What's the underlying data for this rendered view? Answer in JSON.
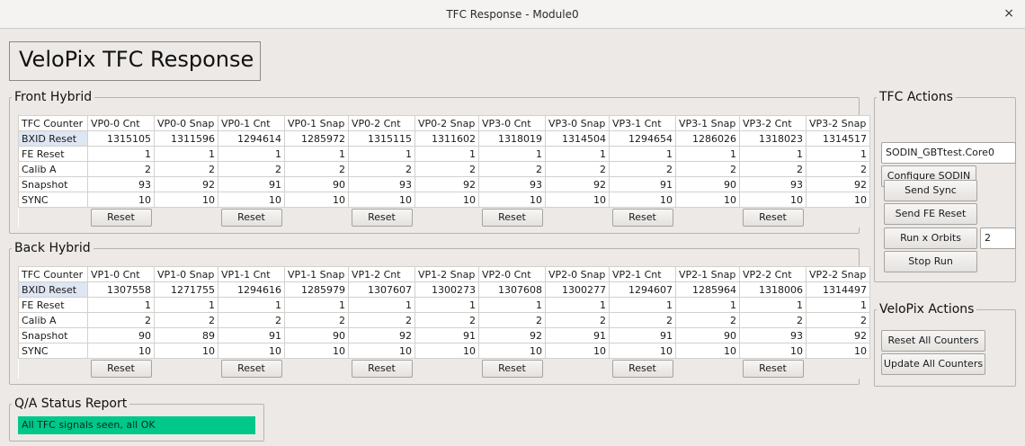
{
  "window": {
    "title": "TFC Response - Module0",
    "close": "×"
  },
  "app_title": "VeloPix TFC Response",
  "front": {
    "legend": "Front Hybrid",
    "header": [
      "TFC Counter",
      "VP0-0 Cnt",
      "VP0-0 Snap",
      "VP0-1 Cnt",
      "VP0-1 Snap",
      "VP0-2 Cnt",
      "VP0-2 Snap",
      "VP3-0 Cnt",
      "VP3-0 Snap",
      "VP3-1 Cnt",
      "VP3-1 Snap",
      "VP3-2 Cnt",
      "VP3-2 Snap"
    ],
    "rows": [
      {
        "label": "BXID Reset",
        "values": [
          "1315105",
          "1311596",
          "1294614",
          "1285972",
          "1315115",
          "1311602",
          "1318019",
          "1314504",
          "1294654",
          "1286026",
          "1318023",
          "1314517"
        ]
      },
      {
        "label": "FE Reset",
        "values": [
          "1",
          "1",
          "1",
          "1",
          "1",
          "1",
          "1",
          "1",
          "1",
          "1",
          "1",
          "1"
        ]
      },
      {
        "label": "Calib A",
        "values": [
          "2",
          "2",
          "2",
          "2",
          "2",
          "2",
          "2",
          "2",
          "2",
          "2",
          "2",
          "2"
        ]
      },
      {
        "label": "Snapshot",
        "values": [
          "93",
          "92",
          "91",
          "90",
          "93",
          "92",
          "93",
          "92",
          "91",
          "90",
          "93",
          "92"
        ]
      },
      {
        "label": "SYNC",
        "values": [
          "10",
          "10",
          "10",
          "10",
          "10",
          "10",
          "10",
          "10",
          "10",
          "10",
          "10",
          "10"
        ]
      }
    ],
    "reset_label": "Reset"
  },
  "back": {
    "legend": "Back Hybrid",
    "header": [
      "TFC Counter",
      "VP1-0 Cnt",
      "VP1-0 Snap",
      "VP1-1 Cnt",
      "VP1-1 Snap",
      "VP1-2 Cnt",
      "VP1-2 Snap",
      "VP2-0 Cnt",
      "VP2-0 Snap",
      "VP2-1 Cnt",
      "VP2-1 Snap",
      "VP2-2 Cnt",
      "VP2-2 Snap"
    ],
    "rows": [
      {
        "label": "BXID Reset",
        "values": [
          "1307558",
          "1271755",
          "1294616",
          "1285979",
          "1307607",
          "1300273",
          "1307608",
          "1300277",
          "1294607",
          "1285964",
          "1318006",
          "1314497"
        ]
      },
      {
        "label": "FE Reset",
        "values": [
          "1",
          "1",
          "1",
          "1",
          "1",
          "1",
          "1",
          "1",
          "1",
          "1",
          "1",
          "1"
        ]
      },
      {
        "label": "Calib A",
        "values": [
          "2",
          "2",
          "2",
          "2",
          "2",
          "2",
          "2",
          "2",
          "2",
          "2",
          "2",
          "2"
        ]
      },
      {
        "label": "Snapshot",
        "values": [
          "90",
          "89",
          "91",
          "90",
          "92",
          "91",
          "92",
          "91",
          "91",
          "90",
          "93",
          "92"
        ]
      },
      {
        "label": "SYNC",
        "values": [
          "10",
          "10",
          "10",
          "10",
          "10",
          "10",
          "10",
          "10",
          "10",
          "10",
          "10",
          "10"
        ]
      }
    ],
    "reset_label": "Reset"
  },
  "qa": {
    "legend": "Q/A Status Report",
    "status_text": "All TFC signals seen, all OK",
    "status_color": "#00c88a"
  },
  "tfc_actions": {
    "legend": "TFC Actions",
    "target": "SODIN_GBTtest.Core0",
    "configure": "Configure SODIN",
    "send_sync": "Send Sync",
    "send_fe_reset": "Send FE Reset",
    "run_orbits": "Run x Orbits",
    "orbits_value": "2",
    "stop_run": "Stop Run"
  },
  "velopix_actions": {
    "legend": "VeloPix Actions",
    "reset_all": "Reset All Counters",
    "update_all": "Update All Counters"
  }
}
